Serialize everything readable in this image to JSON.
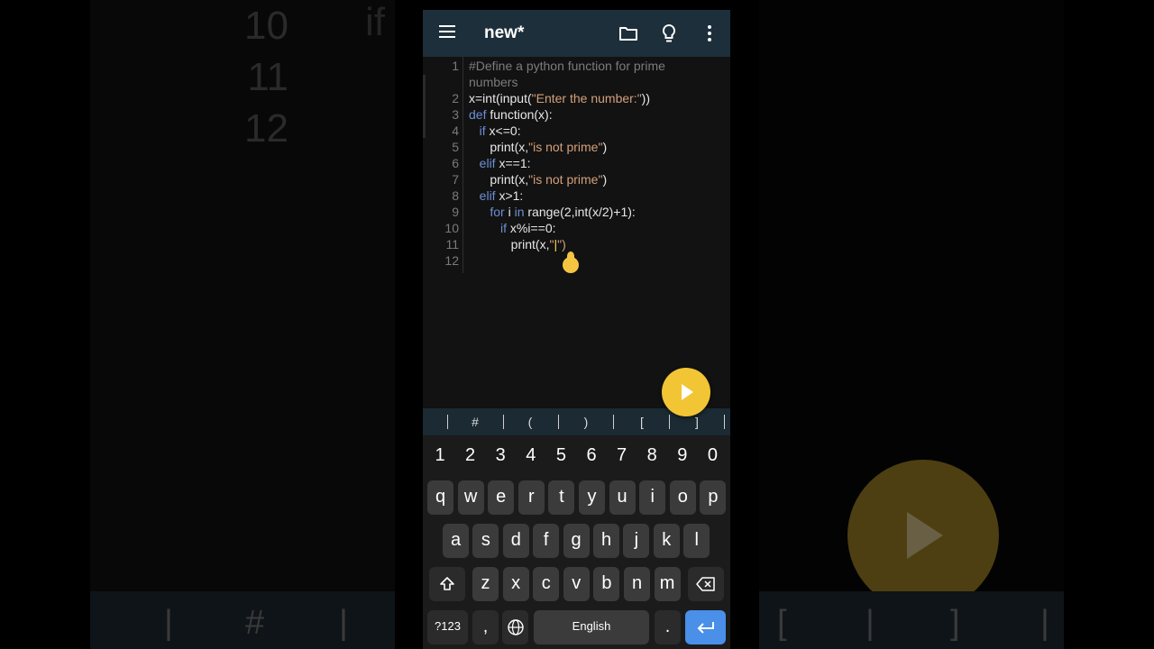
{
  "app": {
    "title": "new*",
    "icons": [
      "hamburger-menu-icon",
      "folder-icon",
      "lightbulb-icon",
      "more-vertical-icon"
    ]
  },
  "editor": {
    "lines": [
      {
        "n": "1",
        "segments": [
          {
            "t": "#Define a python function for prime",
            "c": "cmt"
          }
        ]
      },
      {
        "n": "",
        "segments": [
          {
            "t": "numbers",
            "c": "cmt"
          }
        ]
      },
      {
        "n": "2",
        "segments": [
          {
            "t": "x=int(input(",
            "c": ""
          },
          {
            "t": "\"Enter the number:\"",
            "c": "str"
          },
          {
            "t": "))",
            "c": ""
          }
        ]
      },
      {
        "n": "3",
        "segments": [
          {
            "t": "def",
            "c": "kw"
          },
          {
            "t": " function(x):",
            "c": ""
          }
        ]
      },
      {
        "n": "4",
        "segments": [
          {
            "t": "   ",
            "c": ""
          },
          {
            "t": "if",
            "c": "kw"
          },
          {
            "t": " x<=0:",
            "c": ""
          }
        ]
      },
      {
        "n": "5",
        "segments": [
          {
            "t": "      print(x,",
            "c": ""
          },
          {
            "t": "\"is not prime\"",
            "c": "str"
          },
          {
            "t": ")",
            "c": ""
          }
        ]
      },
      {
        "n": "6",
        "segments": [
          {
            "t": "   ",
            "c": ""
          },
          {
            "t": "elif",
            "c": "kw"
          },
          {
            "t": " x==1:",
            "c": ""
          }
        ]
      },
      {
        "n": "7",
        "segments": [
          {
            "t": "      print(x,",
            "c": ""
          },
          {
            "t": "\"is not prime\"",
            "c": "str"
          },
          {
            "t": ")",
            "c": ""
          }
        ]
      },
      {
        "n": "8",
        "segments": [
          {
            "t": "   ",
            "c": ""
          },
          {
            "t": "elif",
            "c": "kw"
          },
          {
            "t": " x>1:",
            "c": ""
          }
        ]
      },
      {
        "n": "9",
        "segments": [
          {
            "t": "      ",
            "c": ""
          },
          {
            "t": "for",
            "c": "kw"
          },
          {
            "t": " i ",
            "c": ""
          },
          {
            "t": "in",
            "c": "kw"
          },
          {
            "t": " range(2,int(x/2)+1):",
            "c": ""
          }
        ]
      },
      {
        "n": "10",
        "segments": [
          {
            "t": "         ",
            "c": ""
          },
          {
            "t": "if",
            "c": "kw"
          },
          {
            "t": " x%i==0:",
            "c": ""
          }
        ]
      },
      {
        "n": "11",
        "segments": [
          {
            "t": "            print(x,",
            "c": ""
          },
          {
            "t": "\"",
            "c": "str"
          },
          {
            "t": "|",
            "c": "cursor"
          },
          {
            "t": "\")",
            "c": "str"
          }
        ]
      },
      {
        "n": "12",
        "segments": []
      }
    ]
  },
  "run_button": {
    "icon": "play-icon"
  },
  "symbol_bar": [
    "#",
    "(",
    ")",
    "[",
    "]"
  ],
  "keyboard": {
    "numbers": [
      "1",
      "2",
      "3",
      "4",
      "5",
      "6",
      "7",
      "8",
      "9",
      "0"
    ],
    "row1": [
      "q",
      "w",
      "e",
      "r",
      "t",
      "y",
      "u",
      "i",
      "o",
      "p"
    ],
    "row2": [
      "a",
      "s",
      "d",
      "f",
      "g",
      "h",
      "j",
      "k",
      "l"
    ],
    "row3": [
      "z",
      "x",
      "c",
      "v",
      "b",
      "n",
      "m"
    ],
    "bottom": {
      "sym_key": "?123",
      "comma": ",",
      "space": "English",
      "period": "."
    },
    "icons": [
      "shift-icon",
      "backspace-icon",
      "globe-icon",
      "enter-icon"
    ]
  },
  "background": {
    "left_numbers": [
      "10",
      "11",
      "12"
    ],
    "left_keyword": "if",
    "left_bar_symbol": "#",
    "right_bar_symbols": [
      "[",
      "]"
    ]
  },
  "colors": {
    "appbar": "#1d2f3a",
    "keyword": "#6d8fd6",
    "string": "#d4a07a",
    "comment": "#7c7c7c",
    "fab": "#f2c534",
    "enter_key": "#4a8fe8"
  }
}
